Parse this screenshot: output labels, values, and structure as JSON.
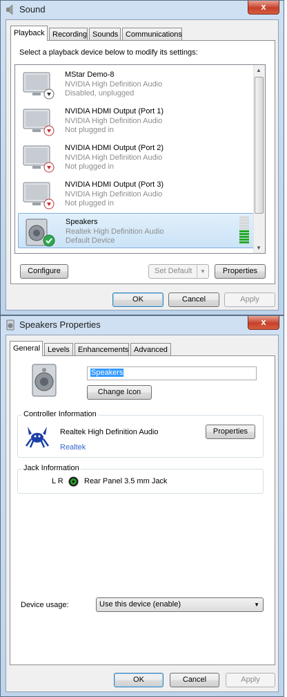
{
  "sound_window": {
    "title": "Sound",
    "close_glyph": "x",
    "tabs": [
      "Playback",
      "Recording",
      "Sounds",
      "Communications"
    ],
    "instruction": "Select a playback device below to modify its settings:",
    "devices": [
      {
        "name": "MStar Demo-8",
        "driver": "NVIDIA High Definition Audio",
        "status": "Disabled, unplugged",
        "icon": "monitor-icon",
        "badge": "down-arrow-badge-icon"
      },
      {
        "name": "NVIDIA HDMI Output (Port 1)",
        "driver": "NVIDIA High Definition Audio",
        "status": "Not plugged in",
        "icon": "monitor-icon",
        "badge": "red-down-arrow-badge-icon"
      },
      {
        "name": "NVIDIA HDMI Output (Port 2)",
        "driver": "NVIDIA High Definition Audio",
        "status": "Not plugged in",
        "icon": "monitor-icon",
        "badge": "red-down-arrow-badge-icon"
      },
      {
        "name": "NVIDIA HDMI Output (Port 3)",
        "driver": "NVIDIA High Definition Audio",
        "status": "Not plugged in",
        "icon": "monitor-icon",
        "badge": "red-down-arrow-badge-icon"
      },
      {
        "name": "Speakers",
        "driver": "Realtek High Definition Audio",
        "status": "Default Device",
        "icon": "speaker-icon",
        "badge": "green-check-badge-icon",
        "level_bars_lit": 5,
        "level_bars_total": 10
      }
    ],
    "buttons": {
      "configure": "Configure",
      "set_default": "Set Default",
      "properties": "Properties",
      "ok": "OK",
      "cancel": "Cancel",
      "apply": "Apply"
    }
  },
  "speakers_window": {
    "title": "Speakers Properties",
    "close_glyph": "x",
    "tabs": [
      "General",
      "Levels",
      "Enhancements",
      "Advanced"
    ],
    "device_name_value": "Speakers",
    "change_icon_label": "Change Icon",
    "controller": {
      "heading": "Controller Information",
      "name": "Realtek High Definition Audio",
      "vendor_link": "Realtek",
      "properties_label": "Properties"
    },
    "jack": {
      "heading": "Jack Information",
      "channels": "L R",
      "description": "Rear Panel 3.5 mm Jack"
    },
    "device_usage_label": "Device usage:",
    "device_usage_value": "Use this device (enable)",
    "buttons": {
      "ok": "OK",
      "cancel": "Cancel",
      "apply": "Apply"
    }
  },
  "colors": {
    "selection_border": "#84acdd",
    "link": "#3366cc",
    "level_green": "#27a827",
    "close_red": "#c6412b"
  }
}
